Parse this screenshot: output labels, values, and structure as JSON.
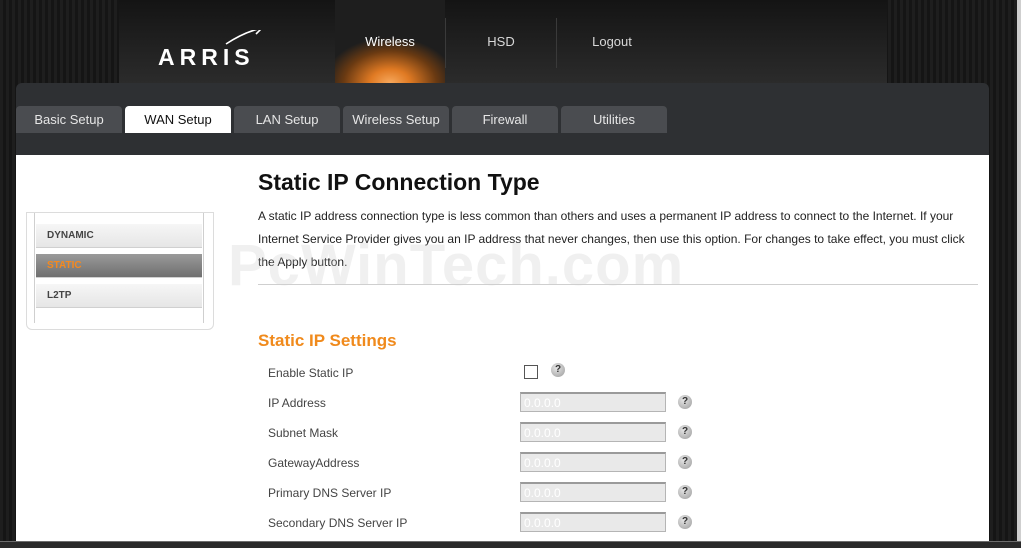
{
  "brand": {
    "name": "ARRIS"
  },
  "top_nav": [
    {
      "label": "Wireless",
      "active": true
    },
    {
      "label": "HSD",
      "active": false
    },
    {
      "label": "Logout",
      "active": false
    }
  ],
  "tabs": [
    {
      "label": "Basic Setup",
      "active": false
    },
    {
      "label": "WAN Setup",
      "active": true
    },
    {
      "label": "LAN Setup",
      "active": false
    },
    {
      "label": "Wireless Setup",
      "active": false
    },
    {
      "label": "Firewall",
      "active": false
    },
    {
      "label": "Utilities",
      "active": false
    }
  ],
  "side_nav": [
    {
      "label": "DYNAMIC",
      "active": false
    },
    {
      "label": "STATIC",
      "active": true
    },
    {
      "label": "L2TP",
      "active": false
    }
  ],
  "page": {
    "title": "Static IP Connection Type",
    "description": "A static IP address connection type is less common than others and uses a permanent IP address to connect to the Internet. If your Internet Service Provider gives you an IP address that never changes, then use this option. For changes to take effect, you must click the Apply button.",
    "section_title": "Static IP Settings"
  },
  "settings": {
    "enable_static_ip": {
      "label": "Enable Static IP",
      "checked": false
    },
    "fields": [
      {
        "label": "IP Address",
        "value": "0.0.0.0"
      },
      {
        "label": "Subnet Mask",
        "value": "0.0.0.0"
      },
      {
        "label": "GatewayAddress",
        "value": "0.0.0.0"
      },
      {
        "label": "Primary DNS Server IP",
        "value": "0.0.0.0"
      },
      {
        "label": "Secondary DNS Server IP",
        "value": "0.0.0.0"
      }
    ],
    "help_symbol": "?"
  },
  "watermark": "PcWinTech.com",
  "colors": {
    "accent": "#f08a1c",
    "tab_active": "#ffffff",
    "tab_inactive": "#4a4c50"
  }
}
